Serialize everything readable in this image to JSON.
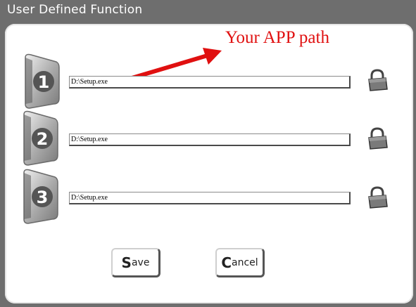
{
  "window": {
    "title": "User Defined Function"
  },
  "annotation": {
    "text": "Your APP path",
    "color": "#e01010"
  },
  "rows": [
    {
      "number": "1",
      "path": "D:\\Setup.exe"
    },
    {
      "number": "2",
      "path": "D:\\Setup.exe"
    },
    {
      "number": "3",
      "path": "D:\\Setup.exe"
    }
  ],
  "buttons": {
    "save": {
      "first": "S",
      "rest": "ave"
    },
    "cancel": {
      "first": "C",
      "rest": "ancel"
    }
  },
  "icons": {
    "row_browse": "padlock-icon",
    "row_badge": "number-badge"
  }
}
